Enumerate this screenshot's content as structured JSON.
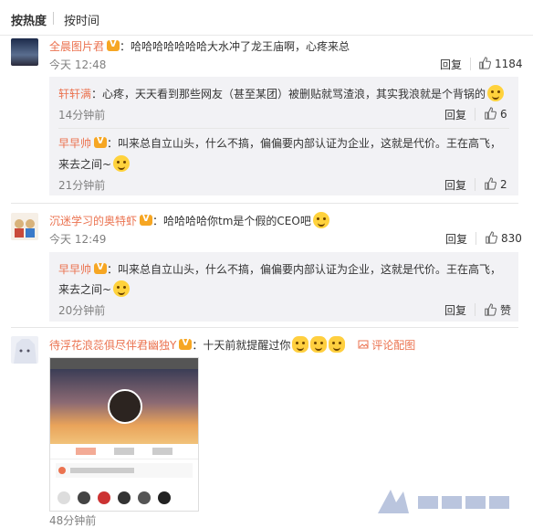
{
  "tabs": {
    "hot": "按热度",
    "time": "按时间"
  },
  "comments": [
    {
      "user": "全晨图片君",
      "text": "：哈哈哈哈哈哈哈大水冲了龙王庙啊，心疼来总",
      "time": "今天 12:48",
      "reply_label": "回复",
      "likes": "1184",
      "replies": [
        {
          "user": "轩轩满",
          "text": "：心疼，天天看到那些网友（甚至某团）被删贴就骂渣浪，其实我浪就是个背锅的",
          "time": "14分钟前",
          "reply_label": "回复",
          "likes": "6"
        },
        {
          "user": "早早帅",
          "text": "：叫来总自立山头，什么不搞，偏偏要内部认证为企业，这就是代价。王在高飞，",
          "text2": "来去之间~",
          "time": "21分钟前",
          "reply_label": "回复",
          "likes": "2"
        }
      ]
    },
    {
      "user": "沉迷学习的奥特虾",
      "text": "：哈哈哈哈你tm是个假的CEO吧",
      "time": "今天 12:49",
      "reply_label": "回复",
      "likes": "830",
      "replies": [
        {
          "user": "早早帅",
          "text": "：叫来总自立山头，什么不搞，偏偏要内部认证为企业，这就是代价。王在高飞，",
          "text2": "来去之间~",
          "time": "20分钟前",
          "reply_label": "回复",
          "likes": "赞"
        }
      ]
    },
    {
      "user": "待浮花浪蕊俱尽伴君幽独Y",
      "text": "：十天前就提醒过你",
      "pic_comment": "评论配图",
      "time": "48分钟前"
    }
  ],
  "colors": {
    "name": "#eb7350",
    "badge": "#f6a623",
    "reply_bg": "#f2f2f5"
  }
}
